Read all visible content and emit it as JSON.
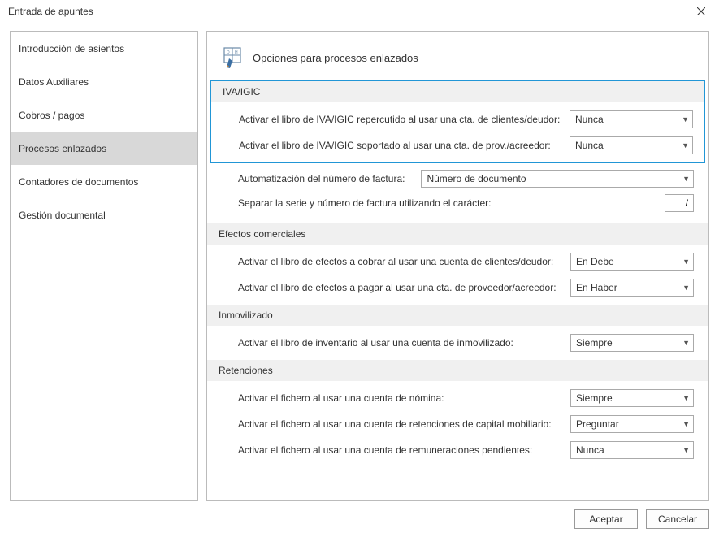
{
  "window": {
    "title": "Entrada de apuntes"
  },
  "sidebar": {
    "items": [
      {
        "label": "Introducción de asientos"
      },
      {
        "label": "Datos Auxiliares"
      },
      {
        "label": "Cobros / pagos"
      },
      {
        "label": "Procesos enlazados"
      },
      {
        "label": "Contadores de documentos"
      },
      {
        "label": "Gestión documental"
      }
    ],
    "selected_index": 3
  },
  "panel": {
    "title": "Opciones para procesos enlazados"
  },
  "sections": {
    "iva": {
      "header": "IVA/IGIC",
      "row1_label": "Activar el libro de IVA/IGIC repercutido al usar una cta. de clientes/deudor:",
      "row1_value": "Nunca",
      "row2_label": "Activar el libro de IVA/IGIC soportado al usar una cta. de prov./acreedor:",
      "row2_value": "Nunca",
      "row3_label": "Automatización del número de factura:",
      "row3_value": "Número de documento",
      "row4_label": "Separar la serie y número de factura utilizando el carácter:",
      "row4_value": "/"
    },
    "efectos": {
      "header": "Efectos comerciales",
      "row1_label": "Activar el libro de efectos a cobrar al usar una cuenta de clientes/deudor:",
      "row1_value": "En Debe",
      "row2_label": "Activar el libro de efectos a pagar al usar una cta. de proveedor/acreedor:",
      "row2_value": "En Haber"
    },
    "inmov": {
      "header": "Inmovilizado",
      "row1_label": "Activar el libro de inventario al usar una cuenta de inmovilizado:",
      "row1_value": "Siempre"
    },
    "ret": {
      "header": "Retenciones",
      "row1_label": "Activar el fichero al usar una cuenta de nómina:",
      "row1_value": "Siempre",
      "row2_label": "Activar el fichero al usar una cuenta de retenciones de capital mobiliario:",
      "row2_value": "Preguntar",
      "row3_label": "Activar el fichero al usar una cuenta de remuneraciones pendientes:",
      "row3_value": "Nunca"
    }
  },
  "footer": {
    "accept": "Aceptar",
    "cancel": "Cancelar"
  }
}
